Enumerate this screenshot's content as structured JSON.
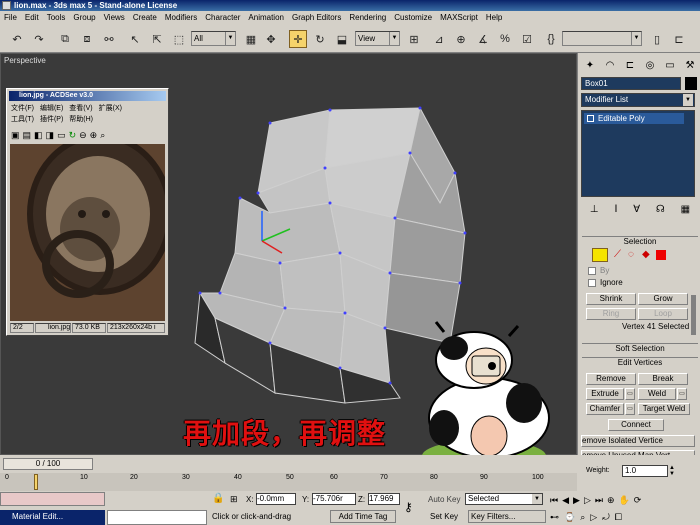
{
  "window": {
    "title": "lion.max - 3ds max 5 - Stand-alone License"
  },
  "menu": [
    "File",
    "Edit",
    "Tools",
    "Group",
    "Views",
    "Create",
    "Modifiers",
    "Character",
    "Animation",
    "Graph Editors",
    "Rendering",
    "Customize",
    "MAXScript",
    "Help"
  ],
  "toolbar": {
    "selection_filter": "All",
    "coord_system": "View"
  },
  "viewport": {
    "label": "Perspective"
  },
  "acdsee": {
    "title": "lion.jpg - ACDSee v3.0",
    "menu_row1": [
      "文件(F)",
      "编辑(E)",
      "查看(V)",
      "扩展(X)"
    ],
    "menu_row2": [
      "工具(T)",
      "插件(P)",
      "帮助(H)"
    ],
    "status_index": "2/2",
    "status_file": "lion.jpg",
    "status_size": "73.0 KB",
    "status_dims": "213x260x24b i"
  },
  "command_panel": {
    "object_name": "Box01",
    "modifier_list": "Modifier List",
    "stack_item": "Editable Poly",
    "selection_title": "Selection",
    "by_label": "By",
    "ignore_label": "Ignore",
    "shrink": "Shrink",
    "grow": "Grow",
    "ring": "Ring",
    "loop": "Loop",
    "selection_status": "Vertex 41 Selected",
    "soft_selection": "Soft Selection",
    "edit_vertices": "Edit Vertices",
    "remove": "Remove",
    "break": "Break",
    "extrude": "Extrude",
    "weld": "Weld",
    "chamfer": "Chamfer",
    "target_weld": "Target Weld",
    "connect": "Connect",
    "remove_isolated": "emove Isolated Vertice",
    "remove_unused": "emove Unused Map Vert",
    "weight_label": "Weight:",
    "weight_value": "1.0"
  },
  "caption": {
    "text": "再加段，再调整"
  },
  "timeline": {
    "frame": "0 / 100",
    "ticks": [
      "0",
      "10",
      "20",
      "30",
      "40",
      "50",
      "60",
      "70",
      "80",
      "90",
      "100"
    ]
  },
  "status": {
    "material_editor": "Material Edit...",
    "x_label": "X:",
    "x_value": "-0.0mm",
    "y_label": "Y:",
    "y_value": "-75.706r",
    "z_label": "Z:",
    "z_value": "17.969",
    "prompt": "Click or click-and-drag",
    "add_time_tag": "Add Time Tag",
    "auto_key": "Auto Key",
    "auto_key_value": "Selected",
    "set_key": "Set Key",
    "key_filters": "Key Filters..."
  },
  "colors": {
    "title_blue": "#0a246a",
    "caption_red": "#e01010",
    "poly_yellow": "#f5e400"
  }
}
